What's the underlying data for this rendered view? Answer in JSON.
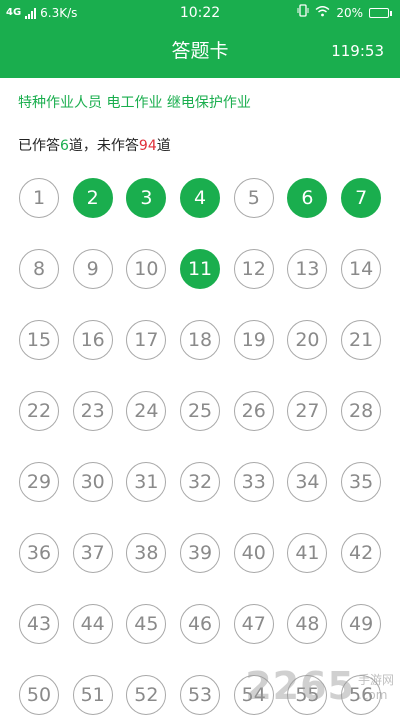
{
  "status_bar": {
    "network": "4G",
    "speed": "6.3K/s",
    "time": "10:22",
    "battery": "20%",
    "icons": [
      "signal-icon",
      "vibrate-icon",
      "wifi-icon",
      "battery-icon"
    ]
  },
  "header": {
    "title": "答题卡",
    "timer": "119:53"
  },
  "subject": "特种作业人员 电工作业 继电保护作业",
  "summary": {
    "prefix": "已作答",
    "answered": "6",
    "middle": "道，未作答",
    "unanswered": "94",
    "suffix": "道"
  },
  "questions": [
    {
      "n": "1",
      "answered": false
    },
    {
      "n": "2",
      "answered": true
    },
    {
      "n": "3",
      "answered": true
    },
    {
      "n": "4",
      "answered": true
    },
    {
      "n": "5",
      "answered": false
    },
    {
      "n": "6",
      "answered": true
    },
    {
      "n": "7",
      "answered": true
    },
    {
      "n": "8",
      "answered": false
    },
    {
      "n": "9",
      "answered": false
    },
    {
      "n": "10",
      "answered": false
    },
    {
      "n": "11",
      "answered": true
    },
    {
      "n": "12",
      "answered": false
    },
    {
      "n": "13",
      "answered": false
    },
    {
      "n": "14",
      "answered": false
    },
    {
      "n": "15",
      "answered": false
    },
    {
      "n": "16",
      "answered": false
    },
    {
      "n": "17",
      "answered": false
    },
    {
      "n": "18",
      "answered": false
    },
    {
      "n": "19",
      "answered": false
    },
    {
      "n": "20",
      "answered": false
    },
    {
      "n": "21",
      "answered": false
    },
    {
      "n": "22",
      "answered": false
    },
    {
      "n": "23",
      "answered": false
    },
    {
      "n": "24",
      "answered": false
    },
    {
      "n": "25",
      "answered": false
    },
    {
      "n": "26",
      "answered": false
    },
    {
      "n": "27",
      "answered": false
    },
    {
      "n": "28",
      "answered": false
    },
    {
      "n": "29",
      "answered": false
    },
    {
      "n": "30",
      "answered": false
    },
    {
      "n": "31",
      "answered": false
    },
    {
      "n": "32",
      "answered": false
    },
    {
      "n": "33",
      "answered": false
    },
    {
      "n": "34",
      "answered": false
    },
    {
      "n": "35",
      "answered": false
    },
    {
      "n": "36",
      "answered": false
    },
    {
      "n": "37",
      "answered": false
    },
    {
      "n": "38",
      "answered": false
    },
    {
      "n": "39",
      "answered": false
    },
    {
      "n": "40",
      "answered": false
    },
    {
      "n": "41",
      "answered": false
    },
    {
      "n": "42",
      "answered": false
    },
    {
      "n": "43",
      "answered": false
    },
    {
      "n": "44",
      "answered": false
    },
    {
      "n": "45",
      "answered": false
    },
    {
      "n": "46",
      "answered": false
    },
    {
      "n": "47",
      "answered": false
    },
    {
      "n": "48",
      "answered": false
    },
    {
      "n": "49",
      "answered": false
    },
    {
      "n": "50",
      "answered": false
    },
    {
      "n": "51",
      "answered": false
    },
    {
      "n": "52",
      "answered": false
    },
    {
      "n": "53",
      "answered": false
    },
    {
      "n": "54",
      "answered": false
    },
    {
      "n": "55",
      "answered": false
    },
    {
      "n": "56",
      "answered": false
    }
  ],
  "watermark": {
    "number": "2265",
    "cn": "手游网",
    "domain": ".com"
  },
  "colors": {
    "accent": "#1aae4e",
    "unanswered_count": "#e0303a",
    "circle_border": "#a9a9a9"
  }
}
